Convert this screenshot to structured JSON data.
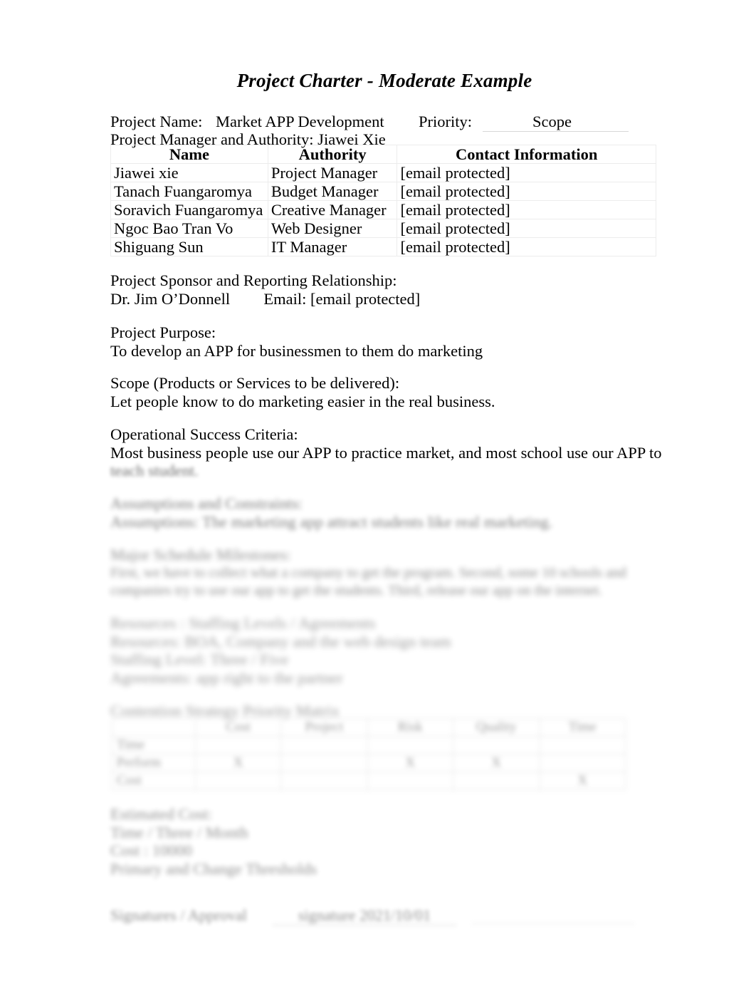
{
  "document": {
    "title": "Project Charter - Moderate Example"
  },
  "header": {
    "project_name_label": "Project Name:",
    "project_name_value": "Market APP Development",
    "priority_label": "Priority:",
    "priority_value": "Scope",
    "manager_line": "Project Manager and Authority: Jiawei Xie"
  },
  "team_table": {
    "columns": [
      "Name",
      "Authority",
      "Contact Information"
    ],
    "rows": [
      [
        "Jiawei xie",
        "Project Manager",
        "[email protected]"
      ],
      [
        "Tanach Fuangaromya",
        "Budget Manager",
        "[email protected]"
      ],
      [
        "Soravich Fuangaromya",
        "Creative Manager",
        "[email protected]"
      ],
      [
        "Ngoc Bao Tran Vo",
        "Web Designer",
        "[email protected]"
      ],
      [
        "Shiguang Sun",
        "IT Manager",
        "[email protected]"
      ]
    ]
  },
  "sponsor": {
    "heading": "Project Sponsor and Reporting Relationship:",
    "name": "Dr. Jim O’Donnell",
    "email_line": "Email: [email protected]"
  },
  "purpose": {
    "heading": "Project Purpose:",
    "body": "To develop an APP for businessmen to them do marketing"
  },
  "scope": {
    "heading": "Scope (Products or Services to be delivered):",
    "body": "Let people know to do marketing easier in the real business."
  },
  "success_criteria": {
    "heading": "Operational Success Criteria:",
    "body_line1": "Most business people use our APP to practice market, and most school use our APP to",
    "body_line2": "teach student."
  },
  "assumptions": {
    "heading": "Assumptions and Constraints:",
    "body": "Assumptions: The marketing app attract students like real marketing."
  },
  "milestones": {
    "heading": "Major Schedule Milestones:",
    "line1": "First, we have to collect what a company to get the program. Second, some 10 schools and",
    "line2": "companies try to use our app to get the students. Third, release our app on the internet."
  },
  "resources": {
    "heading": "Resources : Staffing Levels / Agreements",
    "line1": "Resources: BOA, Company and the web design team",
    "line2": "Staffing Level: Three / Five",
    "line3": "Agreements: app right to the partner"
  },
  "matrix": {
    "heading": "Contention Strategy Priority Matrix",
    "columns": [
      "",
      "Cost",
      "Project",
      "Risk",
      "Quality",
      "Time"
    ],
    "rows": [
      {
        "label": "Time",
        "cells": [
          "",
          "",
          "",
          "",
          ""
        ]
      },
      {
        "label": "Perform",
        "cells": [
          "X",
          "",
          "X",
          "X",
          ""
        ]
      },
      {
        "label": "Cost",
        "cells": [
          "",
          "",
          "",
          "",
          "X"
        ]
      }
    ]
  },
  "estimated_cost": {
    "heading": "Estimated Cost:",
    "line1": "Time / Three / Month",
    "line2": "Cost : 10000",
    "line3": "Primary and Change Thresholds"
  },
  "signature": {
    "label": "Signatures / Approval",
    "line1_value": "signature      2021/10/01",
    "line2_value": ""
  }
}
